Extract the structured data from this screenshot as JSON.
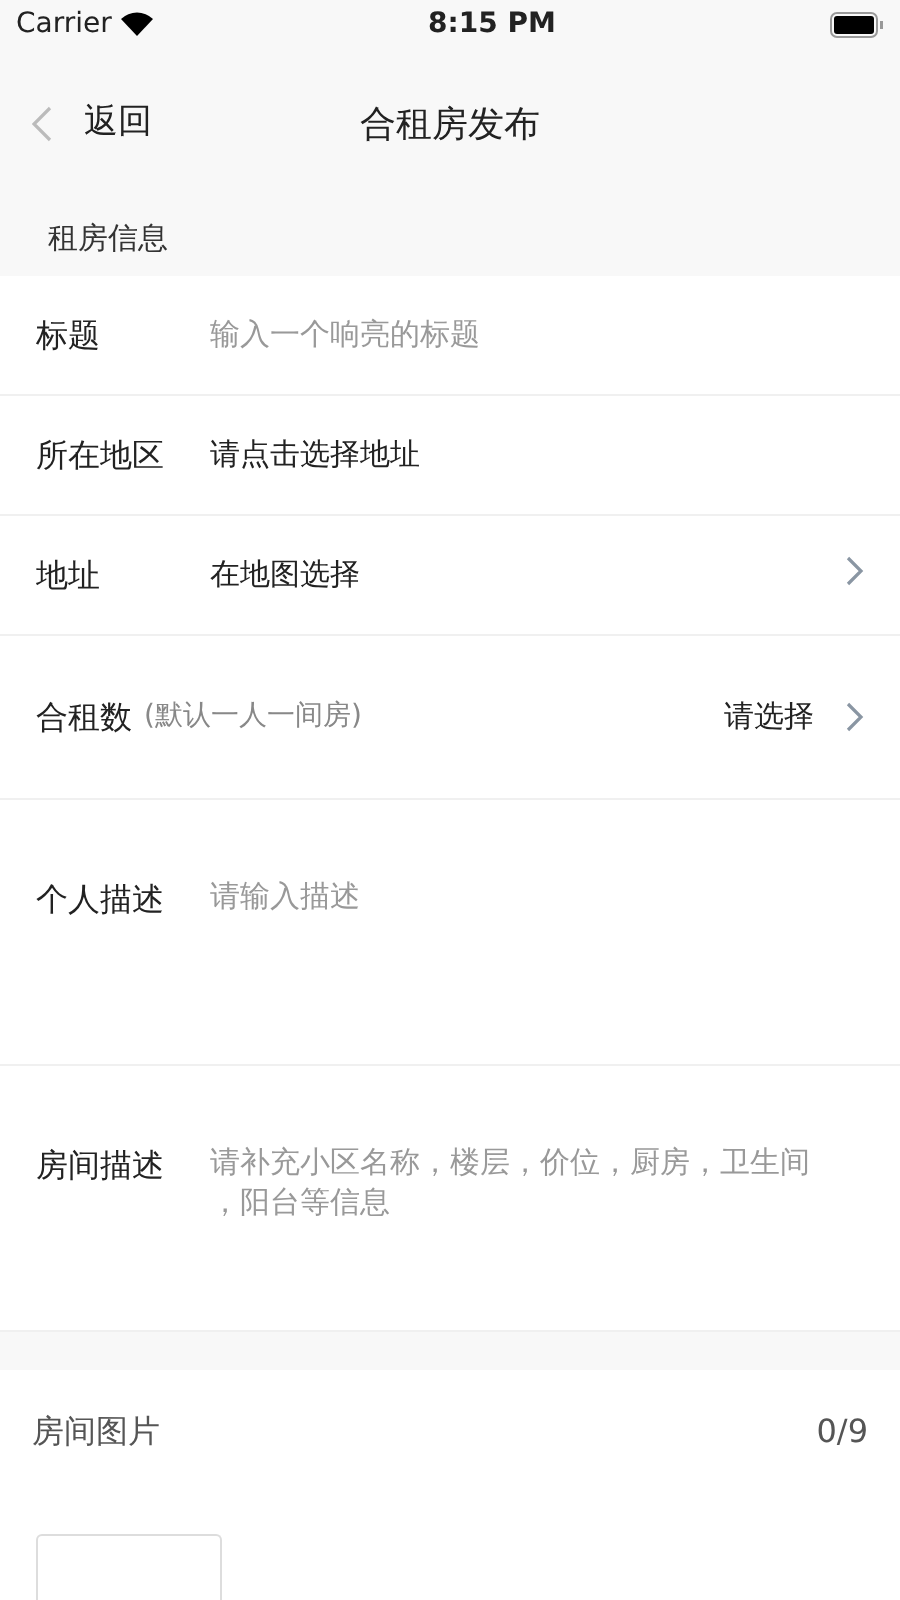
{
  "status_bar": {
    "carrier": "Carrier",
    "time": "8:15 PM"
  },
  "nav": {
    "back": "返回",
    "title": "合租房发布"
  },
  "section": "租房信息",
  "fields": [
    {
      "kind": "input",
      "label": "标题",
      "placeholder": "输入一个响亮的标题"
    },
    {
      "kind": "picker",
      "label": "所在地区",
      "value": "请点击选择地址"
    },
    {
      "kind": "picker",
      "label": "地址",
      "value": "在地图选择",
      "chevron": true
    },
    {
      "kind": "select",
      "label": "合租数",
      "hint": "(默认一人一间房)",
      "value": "请选择"
    },
    {
      "kind": "textarea",
      "label": "个人描述",
      "placeholder": "请输入描述"
    },
    {
      "kind": "textarea",
      "label": "房间描述",
      "placeholder": "请补充小区名称，楼层，价位，厨房，卫生间，阳台等信息"
    }
  ],
  "photos": {
    "label": "房间图片",
    "count": "0/9"
  }
}
